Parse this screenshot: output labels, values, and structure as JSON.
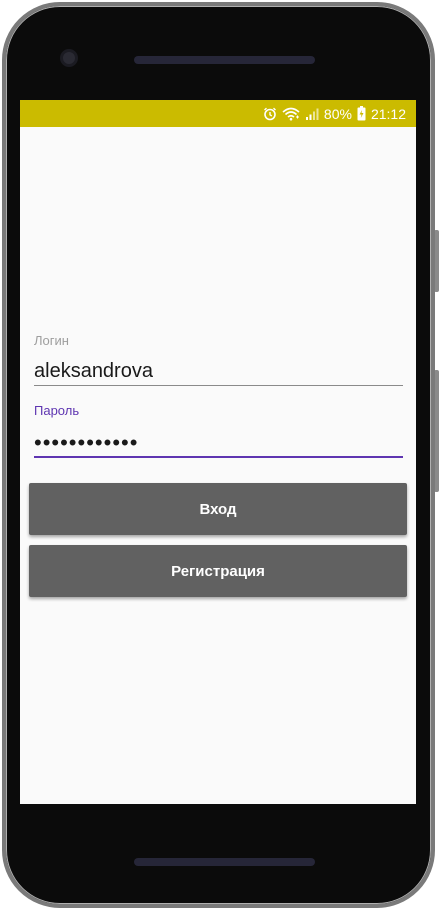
{
  "status_bar": {
    "battery_percent": "80%",
    "time": "21:12",
    "icons": [
      "alarm-icon",
      "wifi-icon",
      "signal-icon",
      "battery-charging-icon"
    ]
  },
  "form": {
    "login_label": "Логин",
    "login_value": "aleksandrova",
    "password_label": "Пароль",
    "password_value": "••••••••••••"
  },
  "buttons": {
    "login_label": "Вход",
    "register_label": "Регистрация"
  },
  "colors": {
    "status_bar": "#cbbb00",
    "accent": "#5e35b1",
    "button": "#616161",
    "screen_background": "#fafafa"
  }
}
